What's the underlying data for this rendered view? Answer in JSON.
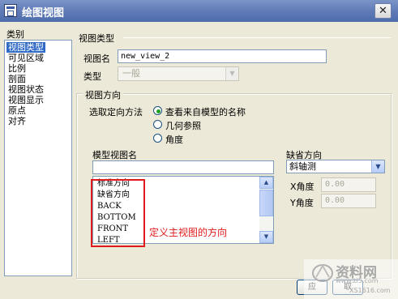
{
  "window": {
    "title": "绘图视图",
    "close_label": "✕"
  },
  "categories": {
    "header": "类别",
    "items": [
      "视图类型",
      "可见区域",
      "比例",
      "剖面",
      "视图状态",
      "视图显示",
      "原点",
      "对齐"
    ],
    "selected_index": 0
  },
  "view_type": {
    "group_title": "视图类型",
    "name_label": "视图名",
    "name_value": "new_view_2",
    "type_label": "类型",
    "type_value": "一般"
  },
  "orientation": {
    "group_title": "视图方向",
    "method_label": "选取定向方法",
    "options": [
      "查看来自模型的名称",
      "几何参照",
      "角度"
    ],
    "selected_index": 0
  },
  "model_views": {
    "label": "模型视图名",
    "search_value": "",
    "items": [
      "标准方向",
      "缺省方向",
      "BACK",
      "BOTTOM",
      "FRONT",
      "LEFT"
    ]
  },
  "default_orientation": {
    "label": "缺省方向",
    "value": "斜轴测",
    "x_label": "X角度",
    "x_value": "0.00",
    "y_label": "Y角度",
    "y_value": "0.00"
  },
  "annotation": {
    "text": "定义主视图的方向"
  },
  "footer": {
    "apply_label": "应",
    "cancel_label": "取"
  },
  "watermark": {
    "text": "资料网",
    "url": "www.zl5.com",
    "stamp_text": "XS1616.com"
  }
}
